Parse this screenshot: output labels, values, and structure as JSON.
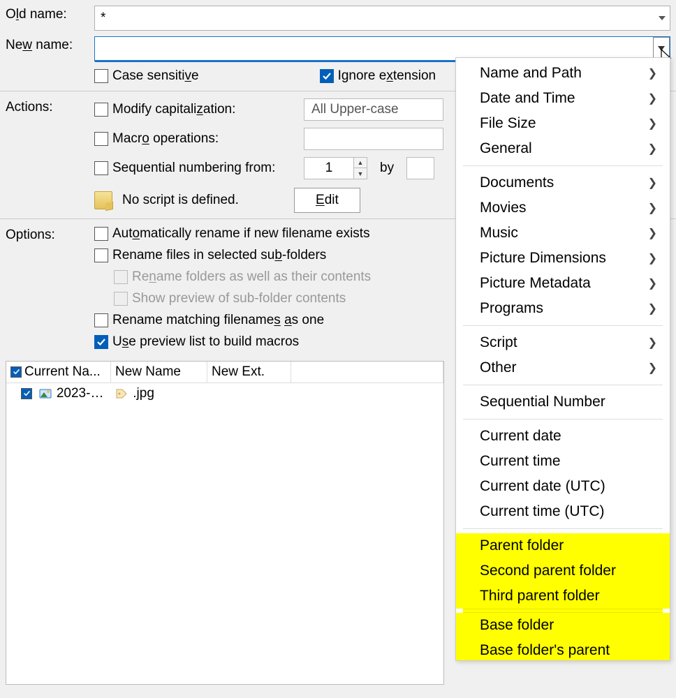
{
  "labels": {
    "old_name": "Old name:",
    "new_name": "New name:",
    "actions": "Actions:",
    "options": "Options:"
  },
  "old_name_value": "*",
  "new_name_value": "",
  "checkboxes": {
    "case_sensitive": {
      "label_pre": "Case sensiti",
      "u": "v",
      "label_post": "e",
      "checked": false
    },
    "ignore_ext": {
      "label_pre": "Ignore e",
      "u": "x",
      "label_post": "tension",
      "checked": true
    },
    "modify_cap": {
      "label_pre": "Modify capitali",
      "u": "z",
      "label_post": "ation:",
      "checked": false
    },
    "macro_ops": {
      "label_pre": "Macr",
      "u": "o",
      "label_post": " operations:",
      "checked": false
    },
    "seq_num": {
      "label": "Sequential numbering from:",
      "checked": false
    },
    "auto_rename": {
      "label_pre": "Aut",
      "u": "o",
      "label_post": "matically rename if new filename exists",
      "checked": false
    },
    "rename_sub": {
      "label_pre": "Rename files in selected su",
      "u": "b",
      "label_post": "-folders",
      "checked": false
    },
    "rename_folders": {
      "label_pre": "Re",
      "u": "n",
      "label_post": "ame folders as well as their contents",
      "checked": false,
      "disabled": true
    },
    "show_preview": {
      "label": "Show preview of sub-folder contents",
      "checked": false,
      "disabled": true
    },
    "rename_one": {
      "label_pre": "Rename matching filename",
      "u": "s a",
      "label_post": "s one",
      "fulllabel": "Rename matching filenames as one",
      "checked": false
    },
    "use_preview": {
      "label_pre": "U",
      "u": "s",
      "label_post": "e preview list to build macros",
      "checked": true
    }
  },
  "capitalization_select": "All Upper-case",
  "seq_start": "1",
  "by_label": "by",
  "script_status": "No script is defined.",
  "edit_btn": {
    "pre": "",
    "u": "E",
    "post": "dit"
  },
  "preview": {
    "headers": [
      "Current Na...",
      "New Name",
      "New Ext.",
      ""
    ],
    "row": {
      "name": "2023-0...",
      "newext": ".jpg"
    }
  },
  "menu": {
    "groups": [
      [
        "Name and Path",
        "Date and Time",
        "File Size",
        "General"
      ],
      [
        "Documents",
        "Movies",
        "Music",
        "Picture Dimensions",
        "Picture Metadata",
        "Programs"
      ],
      [
        "Script",
        "Other"
      ]
    ],
    "seqnum": "Sequential Number",
    "times": [
      "Current date",
      "Current time",
      "Current date (UTC)",
      "Current time (UTC)"
    ],
    "folders1": [
      "Parent folder",
      "Second parent folder",
      "Third parent folder"
    ],
    "folders2": [
      "Base folder",
      "Base folder's parent"
    ]
  }
}
